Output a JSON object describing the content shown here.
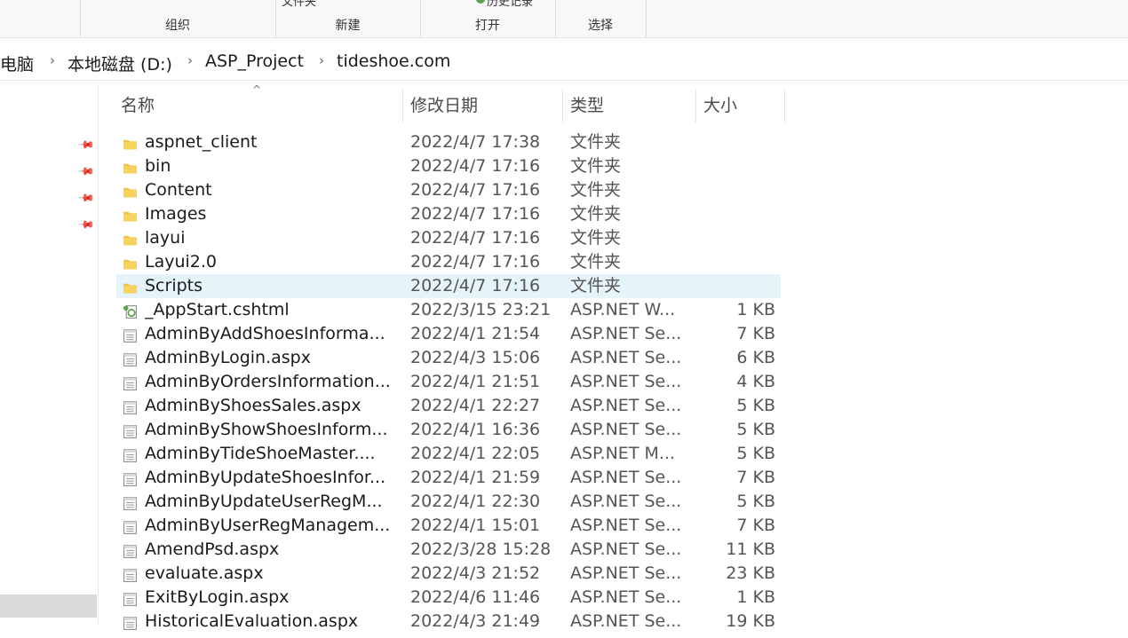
{
  "ribbon": {
    "groups": [
      "组织",
      "新建",
      "打开",
      "选择"
    ],
    "cut_new_label": "文件夹",
    "cut_open_label": "历史记录"
  },
  "address": {
    "crumbs": [
      "电脑",
      "本地磁盘 (D:)",
      "ASP_Project",
      "tideshoe.com"
    ]
  },
  "columns": {
    "name": "名称",
    "date": "修改日期",
    "type": "类型",
    "size": "大小"
  },
  "files": [
    {
      "name": "aspnet_client",
      "date": "2022/4/7 17:38",
      "type": "文件夹",
      "size": "",
      "icon": "folder-icon"
    },
    {
      "name": "bin",
      "date": "2022/4/7 17:16",
      "type": "文件夹",
      "size": "",
      "icon": "folder-icon"
    },
    {
      "name": "Content",
      "date": "2022/4/7 17:16",
      "type": "文件夹",
      "size": "",
      "icon": "folder-icon"
    },
    {
      "name": "Images",
      "date": "2022/4/7 17:16",
      "type": "文件夹",
      "size": "",
      "icon": "folder-icon"
    },
    {
      "name": "layui",
      "date": "2022/4/7 17:16",
      "type": "文件夹",
      "size": "",
      "icon": "folder-icon"
    },
    {
      "name": "Layui2.0",
      "date": "2022/4/7 17:16",
      "type": "文件夹",
      "size": "",
      "icon": "folder-icon"
    },
    {
      "name": "Scripts",
      "date": "2022/4/7 17:16",
      "type": "文件夹",
      "size": "",
      "icon": "folder-icon",
      "selected": true
    },
    {
      "name": "_AppStart.cshtml",
      "date": "2022/3/15 23:21",
      "type": "ASP.NET W...",
      "size": "1 KB",
      "icon": "cshtml-file-icon"
    },
    {
      "name": "AdminByAddShoesInforma...",
      "date": "2022/4/1 21:54",
      "type": "ASP.NET Se...",
      "size": "7 KB",
      "icon": "aspx-file-icon"
    },
    {
      "name": "AdminByLogin.aspx",
      "date": "2022/4/3 15:06",
      "type": "ASP.NET Se...",
      "size": "6 KB",
      "icon": "aspx-file-icon"
    },
    {
      "name": "AdminByOrdersInformation...",
      "date": "2022/4/1 21:51",
      "type": "ASP.NET Se...",
      "size": "4 KB",
      "icon": "aspx-file-icon"
    },
    {
      "name": "AdminByShoesSales.aspx",
      "date": "2022/4/1 22:27",
      "type": "ASP.NET Se...",
      "size": "5 KB",
      "icon": "aspx-file-icon"
    },
    {
      "name": "AdminByShowShoesInform...",
      "date": "2022/4/1 16:36",
      "type": "ASP.NET Se...",
      "size": "5 KB",
      "icon": "aspx-file-icon"
    },
    {
      "name": "AdminByTideShoeMaster....",
      "date": "2022/4/1 22:05",
      "type": "ASP.NET M...",
      "size": "5 KB",
      "icon": "aspx-file-icon"
    },
    {
      "name": "AdminByUpdateShoesInfor...",
      "date": "2022/4/1 21:59",
      "type": "ASP.NET Se...",
      "size": "7 KB",
      "icon": "aspx-file-icon"
    },
    {
      "name": "AdminByUpdateUserRegM...",
      "date": "2022/4/1 22:30",
      "type": "ASP.NET Se...",
      "size": "5 KB",
      "icon": "aspx-file-icon"
    },
    {
      "name": "AdminByUserRegManagem...",
      "date": "2022/4/1 15:01",
      "type": "ASP.NET Se...",
      "size": "7 KB",
      "icon": "aspx-file-icon"
    },
    {
      "name": "AmendPsd.aspx",
      "date": "2022/3/28 15:28",
      "type": "ASP.NET Se...",
      "size": "11 KB",
      "icon": "aspx-file-icon"
    },
    {
      "name": "evaluate.aspx",
      "date": "2022/4/3 21:52",
      "type": "ASP.NET Se...",
      "size": "23 KB",
      "icon": "aspx-file-icon"
    },
    {
      "name": "ExitByLogin.aspx",
      "date": "2022/4/6 11:46",
      "type": "ASP.NET Se...",
      "size": "1 KB",
      "icon": "aspx-file-icon"
    },
    {
      "name": "HistoricalEvaluation.aspx",
      "date": "2022/4/3 21:49",
      "type": "ASP.NET Se...",
      "size": "19 KB",
      "icon": "aspx-file-icon"
    }
  ],
  "colors": {
    "folder": "#f2c43d",
    "selected_row": "#e5f3fb",
    "cshtml_badge": "#5aa34b"
  }
}
